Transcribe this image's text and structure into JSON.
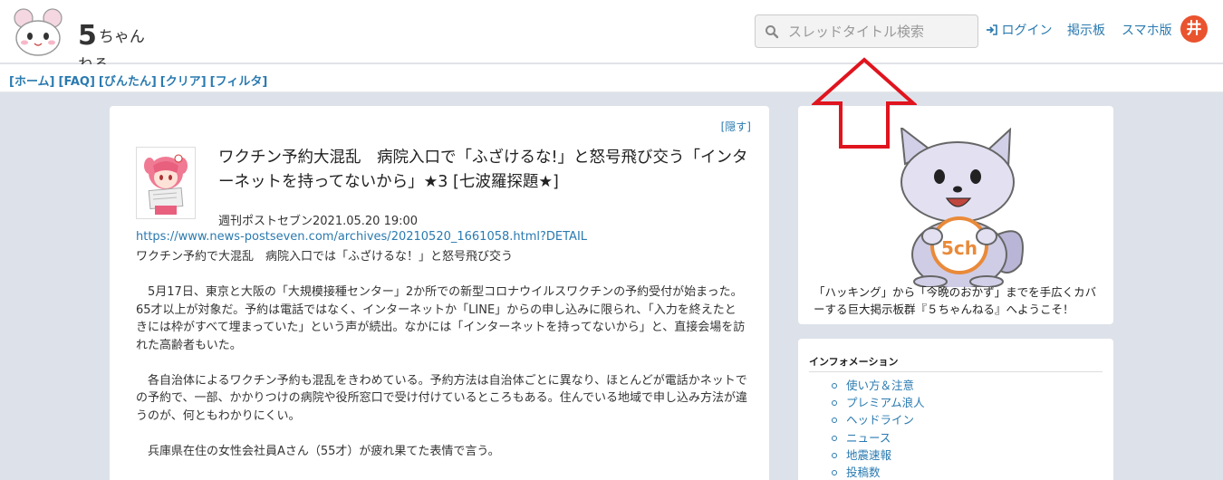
{
  "header": {
    "logo_text": "ちゃんねる",
    "logo_number": "5",
    "search_placeholder": "スレッドタイトル検索",
    "login_label": "ログイン",
    "board_label": "掲示板",
    "mobile_label": "スマホ版",
    "hash_label": "井"
  },
  "subnav": {
    "links": [
      "[ホーム]",
      "[FAQ]",
      "[びんたん]",
      "[クリア]",
      "[フィルタ]"
    ]
  },
  "article": {
    "hide_label": "[隠す]",
    "title": "ワクチン予約大混乱　病院入口で「ふざけるな!」と怒号飛び交う「インターネットを持ってないから」★3 [七波羅探題★]",
    "source_line": "週刊ポストセブン2021.05.20 19:00",
    "url": "https://www.news-postseven.com/archives/20210520_1661058.html?DETAIL",
    "lead": "ワクチン予約で大混乱　病院入口では「ふざけるな！」と怒号飛び交う",
    "paragraphs": [
      "　5月17日、東京と大阪の「大規模接種センター」2か所での新型コロナウイルスワクチンの予約受付が始まった。65才以上が対象だ。予約は電話ではなく、インターネットか「LINE」からの申し込みに限られ、「入力を終えたときには枠がすべて埋まっていた」という声が続出。なかには「インターネットを持ってないから」と、直接会場を訪れた高齢者もいた。",
      "　各自治体によるワクチン予約も混乱をきわめている。予約方法は自治体ごとに異なり、ほとんどが電話かネットでの予約で、一部、かかりつけの病院や役所窓口で受け付けているところもある。住んでいる地域で申し込み方法が違うのが、何ともわかりにくい。",
      "　兵庫県在住の女性会社員Aさん（55才）が疲れ果てた表情で言う。"
    ]
  },
  "sidebar": {
    "welcome": "「ハッキング」から「今晩のおかず」までを手広くカバーする巨大掲示板群『５ちゃんねる』へようこそ！",
    "mascot_badge": "5ch",
    "info_title": "インフォメーション",
    "info_items": [
      "使い方＆注意",
      "プレミアム浪人",
      "ヘッドライン",
      "ニュース",
      "地震速報",
      "投稿数"
    ]
  },
  "colors": {
    "link": "#2a7ab0",
    "page_bg": "#dde2ea",
    "arrow": "#e0141e",
    "hash_button": "#e9532e"
  }
}
